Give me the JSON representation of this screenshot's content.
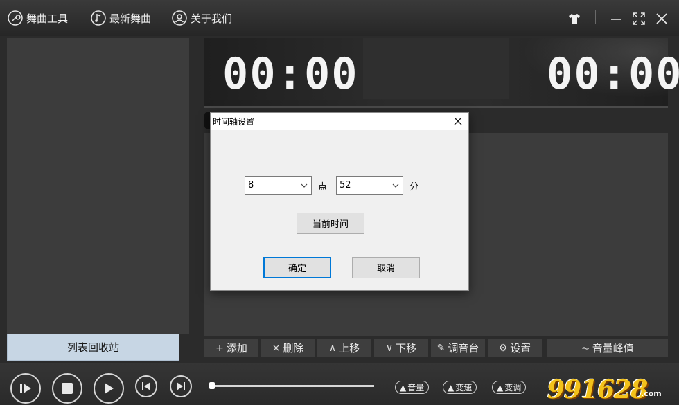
{
  "top_menu": {
    "items": [
      {
        "label": "舞曲工具",
        "icon": "wrench-icon"
      },
      {
        "label": "最新舞曲",
        "icon": "music-note-icon"
      },
      {
        "label": "关于我们",
        "icon": "user-icon"
      }
    ],
    "window_controls": [
      "shirt-skin-icon",
      "minimize-icon",
      "maximize-icon",
      "close-icon"
    ]
  },
  "playlist": {
    "recycle_label": "列表回收站"
  },
  "time_display": {
    "left_time": "00:00",
    "right_time": "00:00"
  },
  "toolbar": {
    "add": {
      "icon": "+",
      "label": "添加"
    },
    "delete": {
      "icon": "×",
      "label": "删除"
    },
    "move_up": {
      "icon": "∧",
      "label": "上移"
    },
    "move_down": {
      "icon": "∨",
      "label": "下移"
    },
    "mixer": {
      "icon": "✎",
      "label": "调音台"
    },
    "settings": {
      "icon": "⚙",
      "label": "设置"
    },
    "volume_peak": {
      "icon": "⏦",
      "label": "音量峰值"
    }
  },
  "player": {
    "progress": 0.0,
    "pills": [
      {
        "arrow": "▲",
        "label": "音量"
      },
      {
        "arrow": "▲",
        "label": "变速"
      },
      {
        "arrow": "▲",
        "label": "变调"
      }
    ],
    "logo_text": "991628",
    "logo_suffix": ".com"
  },
  "dialog": {
    "title": "时间轴设置",
    "hour_value": "8",
    "hour_unit": "点",
    "minute_value": "52",
    "minute_unit": "分",
    "current_time_label": "当前时间",
    "ok_label": "确定",
    "cancel_label": "取消"
  },
  "colors": {
    "background": "#2b2b2b",
    "panel": "#3c3c3c",
    "recycle_button": "#c7d6e4",
    "dialog_bg": "#f0f0f0",
    "default_button_border": "#0078d7",
    "logo_gold": "#f3c21a"
  }
}
